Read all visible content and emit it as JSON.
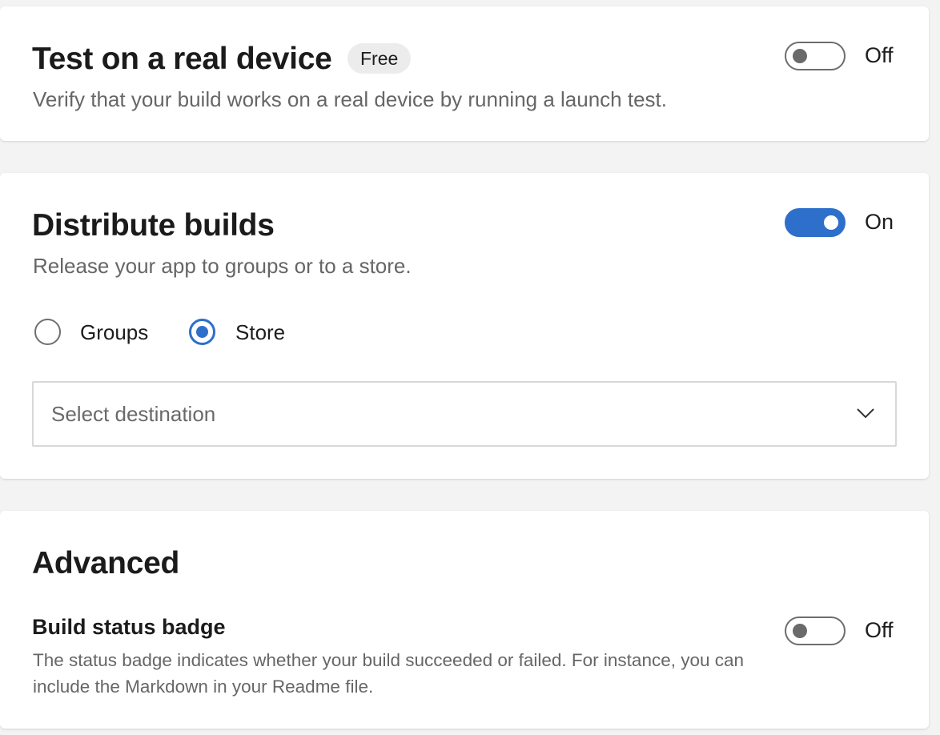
{
  "test_device": {
    "title": "Test on a real device",
    "badge": "Free",
    "description": "Verify that your build works on a real device by running a launch test.",
    "toggle_state": "Off",
    "toggle_on": false
  },
  "distribute": {
    "title": "Distribute builds",
    "description": "Release your app to groups or to a store.",
    "toggle_state": "On",
    "toggle_on": true,
    "options": [
      {
        "label": "Groups",
        "selected": false
      },
      {
        "label": "Store",
        "selected": true
      }
    ],
    "destination_placeholder": "Select destination"
  },
  "advanced": {
    "title": "Advanced",
    "build_status_badge": {
      "title": "Build status badge",
      "description": "The status badge indicates whether your build succeeded or failed. For instance, you can include the Markdown in your Readme file.",
      "toggle_state": "Off",
      "toggle_on": false
    }
  },
  "colors": {
    "accent": "#2d6fcb",
    "background": "#f3f3f3",
    "card": "#ffffff",
    "muted_text": "#666666"
  },
  "icons": {
    "dropdown": "chevron-down-icon"
  }
}
